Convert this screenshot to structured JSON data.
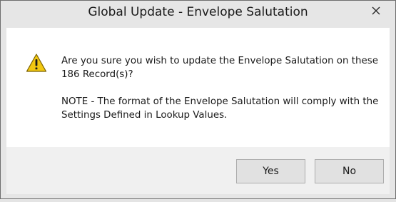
{
  "window": {
    "title": "Global Update - Envelope Salutation"
  },
  "dialog": {
    "icon": "warning-icon",
    "message_line1": "Are you sure you wish to update the Envelope Salutation on these 186 Record(s)?",
    "message_line2": "NOTE - The format of the Envelope Salutation will comply with the Settings Defined in Lookup Values."
  },
  "buttons": {
    "yes_label": "Yes",
    "no_label": "No"
  },
  "colors": {
    "warning_fill": "#f2c811",
    "warning_stroke": "#7a6000",
    "content_bg": "#ffffff",
    "footer_bg": "#f0f0f0",
    "button_bg": "#e1e1e1"
  }
}
